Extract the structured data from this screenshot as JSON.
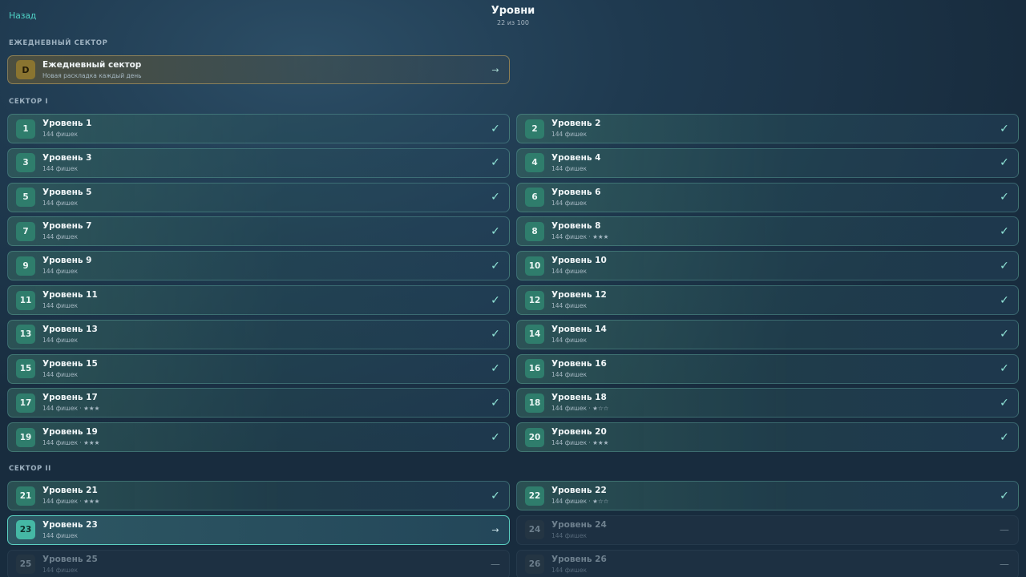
{
  "header": {
    "back_label": "Назад",
    "title": "Уровни",
    "progress": "22 из 100"
  },
  "daily_section": {
    "title": "ЕЖЕДНЕВНЫЙ СЕКТОР",
    "card": {
      "badge": "D",
      "name": "Ежедневный сектор",
      "subtitle": "Новая раскладка каждый день",
      "status_icon": "→"
    }
  },
  "sector1": {
    "title": "СЕКТОР I",
    "levels": [
      {
        "num": "1",
        "name": "Уровень 1",
        "sub": "144 фишек",
        "status": "✓"
      },
      {
        "num": "2",
        "name": "Уровень 2",
        "sub": "144 фишек",
        "status": "✓"
      },
      {
        "num": "3",
        "name": "Уровень 3",
        "sub": "144 фишек",
        "status": "✓"
      },
      {
        "num": "4",
        "name": "Уровень 4",
        "sub": "144 фишек",
        "status": "✓"
      },
      {
        "num": "5",
        "name": "Уровень 5",
        "sub": "144 фишек",
        "status": "✓"
      },
      {
        "num": "6",
        "name": "Уровень 6",
        "sub": "144 фишек",
        "status": "✓"
      },
      {
        "num": "7",
        "name": "Уровень 7",
        "sub": "144 фишек",
        "status": "✓"
      },
      {
        "num": "8",
        "name": "Уровень 8",
        "sub": "144 фишек · ★★★",
        "status": "✓"
      },
      {
        "num": "9",
        "name": "Уровень 9",
        "sub": "144 фишек",
        "status": "✓"
      },
      {
        "num": "10",
        "name": "Уровень 10",
        "sub": "144 фишек",
        "status": "✓"
      },
      {
        "num": "11",
        "name": "Уровень 11",
        "sub": "144 фишек",
        "status": "✓"
      },
      {
        "num": "12",
        "name": "Уровень 12",
        "sub": "144 фишек",
        "status": "✓"
      },
      {
        "num": "13",
        "name": "Уровень 13",
        "sub": "144 фишек",
        "status": "✓"
      },
      {
        "num": "14",
        "name": "Уровень 14",
        "sub": "144 фишек",
        "status": "✓"
      },
      {
        "num": "15",
        "name": "Уровень 15",
        "sub": "144 фишек",
        "status": "✓"
      },
      {
        "num": "16",
        "name": "Уровень 16",
        "sub": "144 фишек",
        "status": "✓"
      },
      {
        "num": "17",
        "name": "Уровень 17",
        "sub": "144 фишек · ★★★",
        "status": "✓"
      },
      {
        "num": "18",
        "name": "Уровень 18",
        "sub": "144 фишек · ★☆☆",
        "status": "✓"
      },
      {
        "num": "19",
        "name": "Уровень 19",
        "sub": "144 фишек · ★★★",
        "status": "✓"
      },
      {
        "num": "20",
        "name": "Уровень 20",
        "sub": "144 фишек · ★★★",
        "status": "✓"
      }
    ]
  },
  "sector2": {
    "title": "СЕКТОР II",
    "levels": [
      {
        "num": "21",
        "name": "Уровень 21",
        "sub": "144 фишек · ★★★",
        "status": "✓",
        "state": "done"
      },
      {
        "num": "22",
        "name": "Уровень 22",
        "sub": "144 фишек · ★☆☆",
        "status": "✓",
        "state": "done"
      },
      {
        "num": "23",
        "name": "Уровень 23",
        "sub": "144 фишек",
        "status": "→",
        "state": "current"
      },
      {
        "num": "24",
        "name": "Уровень 24",
        "sub": "144 фишек",
        "status": "—",
        "state": "locked"
      },
      {
        "num": "25",
        "name": "Уровень 25",
        "sub": "144 фишек",
        "status": "—",
        "state": "locked"
      },
      {
        "num": "26",
        "name": "Уровень 26",
        "sub": "144 фишек",
        "status": "—",
        "state": "locked"
      }
    ]
  },
  "colors": {
    "accent": "#4fd1c5",
    "completed_badge": "#2f7d6c",
    "current_badge": "#45b8a5",
    "daily_badge": "#8a7430"
  },
  "icons": {
    "completed": "check-icon",
    "current": "arrow-right-icon",
    "locked": "dash-icon"
  }
}
